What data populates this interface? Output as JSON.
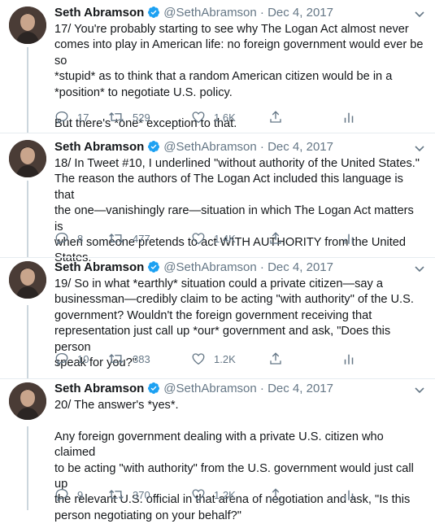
{
  "tweets": [
    {
      "name": "Seth Abramson",
      "handle": "@SethAbramson",
      "separator": "·",
      "date": "Dec 4, 2017",
      "text": "17/ You're probably starting to see why The Logan Act almost never\ncomes into play in American life: no foreign government would ever be so\n*stupid* as to think that a random American citizen would be in a\n*position* to negotiate U.S. policy.\n\nBut there's *one* exception to that.",
      "replies": "17",
      "retweets": "529",
      "likes": "1.6K"
    },
    {
      "name": "Seth Abramson",
      "handle": "@SethAbramson",
      "separator": "·",
      "date": "Dec 4, 2017",
      "text": "18/ In Tweet #10, I underlined \"without authority of the United States.\"\nThe reason the authors of The Logan Act included this language is that\nthe one—vanishingly rare—situation in which The Logan Act matters is\nwhen someone pretends to act WITH AUTHORITY from the United\nStates.",
      "replies": "8",
      "retweets": "477",
      "likes": "1.4K"
    },
    {
      "name": "Seth Abramson",
      "handle": "@SethAbramson",
      "separator": "·",
      "date": "Dec 4, 2017",
      "text": "19/ So in what *earthly* situation could a private citizen—say a\nbusinessman—credibly claim to be acting \"with authority\" of the U.S.\ngovernment? Wouldn't the foreign government receiving that\nrepresentation just call up *our* government and ask, \"Does this person\nspeak for you?\"",
      "replies": "10",
      "retweets": "383",
      "likes": "1.2K"
    },
    {
      "name": "Seth Abramson",
      "handle": "@SethAbramson",
      "separator": "·",
      "date": "Dec 4, 2017",
      "text": "20/ The answer's *yes*.\n\nAny foreign government dealing with a private U.S. citizen who claimed\nto be acting \"with authority\" from the U.S. government would just call up\nthe relevant U.S. official in that arena of negotiation and ask, \"Is this\nperson negotiating on your behalf?\"",
      "replies": "9",
      "retweets": "370",
      "likes": "1.2K"
    }
  ],
  "icons": {
    "verified": "verified-badge-icon",
    "more": "chevron-down-icon",
    "reply": "reply-icon",
    "retweet": "retweet-icon",
    "like": "heart-icon",
    "share": "share-icon",
    "analytics": "analytics-icon"
  },
  "colors": {
    "verified": "#1da1f2",
    "secondary_text": "#657786",
    "thread_line": "#ccd6dd",
    "divider": "#e6ecf0"
  }
}
